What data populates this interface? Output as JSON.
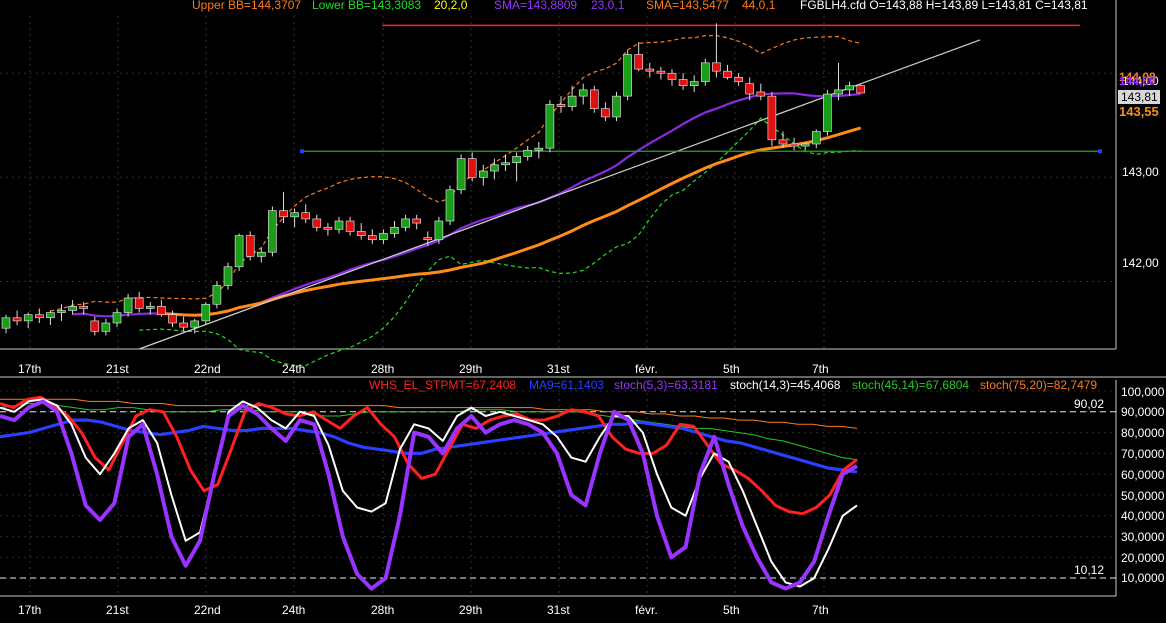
{
  "header": {
    "upper_bb": "Upper BB=144,3707",
    "lower_bb": "Lower BB=143,3083",
    "bb_params": "20,2,0",
    "sma_fast": "SMA=143,8809",
    "sma_fast_params": "23,0,1",
    "sma_slow": "SMA=143,5477",
    "sma_slow_params": "44,0,1",
    "quote": "FGBLH4.cfd O=143,88 H=143,89 L=143,81 C=143,81"
  },
  "price_axis": {
    "labels": [
      "144,00",
      "143,00",
      "142,00"
    ],
    "tag_bb": "144,08",
    "tag_sma": "144,00",
    "tag_close": "143,81",
    "tag_sma_slow": "143,55"
  },
  "date_axis": [
    "17th",
    "21st",
    "22nd",
    "24th",
    "28th",
    "29th",
    "31st",
    "févr.",
    "5th",
    "7th"
  ],
  "indicator": {
    "legend": [
      {
        "text": "WHS_EL_STPMT=67,2408",
        "color": "#ff2020"
      },
      {
        "text": "MA9=61,1403",
        "color": "#2b3fff"
      },
      {
        "text": "stoch(5,3)=63,3181",
        "color": "#9933ff"
      },
      {
        "text": "stoch(14,3)=45,4068",
        "color": "#ffffff"
      },
      {
        "text": "stoch(45,14)=67,6804",
        "color": "#22cc22"
      },
      {
        "text": "stoch(75,20)=82,7479",
        "color": "#ff7a1a"
      }
    ],
    "axis_labels": [
      "100,000",
      "90,0000",
      "80,0000",
      "70,0000",
      "60,0000",
      "50,0000",
      "40,0000",
      "30,0000",
      "20,0000",
      "10,0000"
    ],
    "level_upper": "90,02",
    "level_lower": "10,12"
  },
  "chart_data": [
    {
      "type": "candlestick",
      "title": "FGBLH4.cfd",
      "ylim": [
        141.35,
        144.55
      ],
      "x_ticks": [
        "17th",
        "21st",
        "22nd",
        "24th",
        "28th",
        "29th",
        "31st",
        "févr.",
        "5th",
        "7th"
      ],
      "ohlc": [
        [
          141.55,
          141.68,
          141.5,
          141.65
        ],
        [
          141.65,
          141.72,
          141.58,
          141.62
        ],
        [
          141.62,
          141.7,
          141.55,
          141.68
        ],
        [
          141.68,
          141.74,
          141.6,
          141.65
        ],
        [
          141.65,
          141.72,
          141.58,
          141.7
        ],
        [
          141.7,
          141.78,
          141.62,
          141.72
        ],
        [
          141.72,
          141.82,
          141.68,
          141.76
        ],
        [
          141.76,
          141.8,
          141.68,
          141.74
        ],
        [
          141.62,
          141.66,
          141.48,
          141.52
        ],
        [
          141.52,
          141.64,
          141.48,
          141.6
        ],
        [
          141.6,
          141.74,
          141.56,
          141.7
        ],
        [
          141.7,
          141.88,
          141.66,
          141.84
        ],
        [
          141.84,
          141.9,
          141.7,
          141.74
        ],
        [
          141.74,
          141.8,
          141.68,
          141.76
        ],
        [
          141.76,
          141.82,
          141.66,
          141.68
        ],
        [
          141.68,
          141.72,
          141.56,
          141.6
        ],
        [
          141.6,
          141.66,
          141.52,
          141.56
        ],
        [
          141.56,
          141.64,
          141.5,
          141.62
        ],
        [
          141.62,
          141.8,
          141.58,
          141.78
        ],
        [
          141.78,
          142.0,
          141.74,
          141.96
        ],
        [
          141.96,
          142.18,
          141.92,
          142.14
        ],
        [
          142.14,
          142.46,
          142.1,
          142.44
        ],
        [
          142.44,
          142.48,
          142.2,
          142.24
        ],
        [
          142.24,
          142.32,
          142.18,
          142.28
        ],
        [
          142.28,
          142.72,
          142.24,
          142.68
        ],
        [
          142.68,
          142.86,
          142.56,
          142.62
        ],
        [
          142.62,
          142.7,
          142.52,
          142.66
        ],
        [
          142.66,
          142.74,
          142.56,
          142.6
        ],
        [
          142.6,
          142.64,
          142.48,
          142.52
        ],
        [
          142.52,
          142.56,
          142.44,
          142.5
        ],
        [
          142.5,
          142.62,
          142.46,
          142.58
        ],
        [
          142.58,
          142.62,
          142.44,
          142.48
        ],
        [
          142.48,
          142.56,
          142.4,
          142.44
        ],
        [
          142.44,
          142.5,
          142.36,
          142.4
        ],
        [
          142.4,
          142.5,
          142.36,
          142.46
        ],
        [
          142.46,
          142.58,
          142.42,
          142.52
        ],
        [
          142.52,
          142.64,
          142.48,
          142.6
        ],
        [
          142.6,
          142.64,
          142.5,
          142.56
        ],
        [
          142.42,
          142.48,
          142.34,
          142.4
        ],
        [
          142.4,
          142.62,
          142.36,
          142.58
        ],
        [
          142.58,
          142.92,
          142.54,
          142.88
        ],
        [
          142.88,
          143.22,
          142.84,
          143.18
        ],
        [
          143.18,
          143.24,
          142.96,
          143.0
        ],
        [
          143.0,
          143.12,
          142.92,
          143.06
        ],
        [
          143.06,
          143.18,
          142.98,
          143.12
        ],
        [
          143.12,
          143.22,
          143.06,
          143.14
        ],
        [
          143.14,
          143.24,
          142.96,
          143.2
        ],
        [
          143.2,
          143.3,
          143.16,
          143.26
        ],
        [
          143.26,
          143.34,
          143.18,
          143.28
        ],
        [
          143.28,
          143.74,
          143.24,
          143.7
        ],
        [
          143.7,
          143.78,
          143.62,
          143.68
        ],
        [
          143.68,
          143.88,
          143.64,
          143.78
        ],
        [
          143.78,
          143.9,
          143.7,
          143.84
        ],
        [
          143.84,
          143.88,
          143.62,
          143.66
        ],
        [
          143.66,
          143.72,
          143.54,
          143.58
        ],
        [
          143.58,
          143.82,
          143.54,
          143.78
        ],
        [
          143.78,
          144.22,
          143.74,
          144.18
        ],
        [
          144.18,
          144.3,
          144.02,
          144.04
        ],
        [
          144.04,
          144.1,
          143.96,
          144.02
        ],
        [
          144.02,
          144.06,
          143.94,
          144.0
        ],
        [
          144.0,
          144.04,
          143.88,
          143.94
        ],
        [
          143.94,
          144.0,
          143.84,
          143.88
        ],
        [
          143.88,
          143.98,
          143.82,
          143.92
        ],
        [
          143.92,
          144.14,
          143.88,
          144.1
        ],
        [
          144.1,
          144.48,
          143.96,
          144.02
        ],
        [
          144.02,
          144.08,
          143.94,
          143.96
        ],
        [
          143.96,
          144.0,
          143.88,
          143.92
        ],
        [
          143.9,
          143.96,
          143.74,
          143.8
        ],
        [
          143.82,
          143.9,
          143.74,
          143.78
        ],
        [
          143.78,
          143.82,
          143.3,
          143.36
        ],
        [
          143.36,
          143.44,
          143.28,
          143.32
        ],
        [
          143.32,
          143.38,
          143.26,
          143.3
        ],
        [
          143.3,
          143.34,
          143.26,
          143.32
        ],
        [
          143.32,
          143.46,
          143.28,
          143.44
        ],
        [
          143.44,
          143.84,
          143.4,
          143.8
        ],
        [
          143.8,
          144.1,
          143.74,
          143.84
        ],
        [
          143.84,
          143.92,
          143.78,
          143.88
        ],
        [
          143.88,
          143.89,
          143.81,
          143.81
        ]
      ],
      "lines": [
        {
          "name": "Upper BB",
          "color": "#ff7a1a",
          "style": "dashed"
        },
        {
          "name": "Lower BB",
          "color": "#22dd22",
          "style": "dashed"
        },
        {
          "name": "SMA 23",
          "color": "#8a2be2"
        },
        {
          "name": "SMA 44",
          "color": "#ff8c1a"
        },
        {
          "name": "trend",
          "color": "#cfcfcf"
        },
        {
          "name": "resistance",
          "color": "#ff2020",
          "value": 144.46
        },
        {
          "name": "support",
          "color": "#22aa22",
          "value": 143.25
        }
      ]
    },
    {
      "type": "line",
      "ylim": [
        0,
        100
      ],
      "levels": [
        90.02,
        10.12
      ],
      "series": [
        {
          "name": "WHS_EL_STPMT",
          "color": "#ff2020",
          "values": [
            94,
            92,
            96,
            97,
            93,
            88,
            80,
            68,
            62,
            75,
            88,
            91,
            90,
            78,
            62,
            52,
            55,
            72,
            90,
            94,
            92,
            89,
            88,
            90,
            86,
            82,
            88,
            92,
            84,
            78,
            65,
            58,
            60,
            72,
            84,
            82,
            86,
            88,
            89,
            86,
            86,
            88,
            91,
            90,
            88,
            78,
            72,
            70,
            70,
            74,
            84,
            83,
            74,
            65,
            62,
            58,
            52,
            45,
            42,
            41,
            44,
            50,
            62,
            67
          ]
        },
        {
          "name": "MA9",
          "color": "#2b3fff",
          "values": [
            78,
            79,
            80,
            82,
            84,
            86,
            86,
            85,
            83,
            81,
            80,
            79,
            80,
            81,
            83,
            82,
            81,
            81,
            82,
            82,
            82,
            81,
            80,
            78,
            75,
            73,
            72,
            71,
            70,
            70,
            72,
            73,
            74,
            75,
            76,
            77,
            78,
            79,
            80,
            81,
            82,
            83,
            84,
            84,
            85,
            84,
            83,
            82,
            80,
            78,
            76,
            75,
            73,
            71,
            69,
            67,
            65,
            63,
            62,
            61
          ]
        },
        {
          "name": "stoch(5,3)",
          "color": "#9933ff",
          "values": [
            88,
            86,
            92,
            95,
            90,
            70,
            45,
            38,
            46,
            78,
            84,
            60,
            30,
            16,
            28,
            60,
            88,
            93,
            89,
            82,
            76,
            86,
            84,
            60,
            30,
            12,
            5,
            10,
            40,
            80,
            78,
            70,
            82,
            88,
            80,
            84,
            86,
            84,
            80,
            70,
            50,
            45,
            70,
            90,
            86,
            70,
            40,
            20,
            25,
            60,
            78,
            55,
            35,
            20,
            8,
            5,
            8,
            18,
            40,
            60,
            64
          ]
        },
        {
          "name": "stoch(14,3)",
          "color": "#ffffff",
          "values": [
            92,
            90,
            95,
            96,
            93,
            84,
            68,
            60,
            70,
            82,
            86,
            75,
            50,
            28,
            32,
            60,
            90,
            95,
            92,
            86,
            82,
            90,
            88,
            74,
            52,
            44,
            42,
            46,
            72,
            84,
            82,
            76,
            88,
            92,
            88,
            90,
            88,
            86,
            84,
            78,
            68,
            66,
            78,
            88,
            88,
            80,
            60,
            44,
            40,
            58,
            70,
            66,
            52,
            35,
            18,
            8,
            6,
            10,
            24,
            40,
            45
          ]
        },
        {
          "name": "stoch(45,14)",
          "color": "#22cc22",
          "values": [
            92,
            93,
            94,
            94,
            93,
            92,
            91,
            91,
            92,
            92,
            91,
            90,
            90,
            90,
            90,
            91,
            91,
            91,
            90,
            90,
            90,
            89,
            88,
            88,
            89,
            90,
            90,
            90,
            90,
            90,
            90,
            90,
            91,
            91,
            91,
            90,
            90,
            90,
            90,
            90,
            89,
            88,
            87,
            86,
            85,
            84,
            83,
            82,
            82,
            81,
            80,
            79,
            77,
            76,
            74,
            72,
            70,
            68,
            67
          ]
        },
        {
          "name": "stoch(75,20)",
          "color": "#ff7a1a",
          "values": [
            96,
            96,
            96,
            96,
            96,
            96,
            95,
            95,
            95,
            94,
            94,
            94,
            93,
            93,
            93,
            93,
            93,
            93,
            93,
            93,
            93,
            93,
            93,
            93,
            93,
            93,
            93,
            92,
            92,
            92,
            92,
            92,
            92,
            92,
            92,
            92,
            92,
            91,
            91,
            91,
            91,
            90,
            90,
            90,
            89,
            89,
            88,
            88,
            87,
            87,
            86,
            86,
            85,
            85,
            84,
            84,
            83,
            83,
            82
          ]
        }
      ]
    }
  ]
}
